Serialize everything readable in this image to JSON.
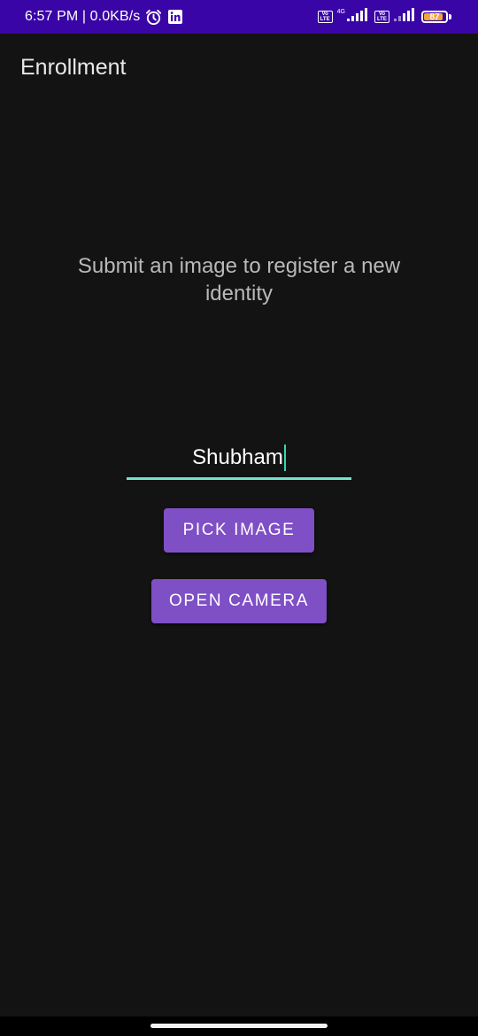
{
  "status_bar": {
    "time": "6:57 PM",
    "network_speed": "0.0KB/s",
    "alarm_icon": "alarm-clock-icon",
    "app_icon": "linkedin-icon",
    "sim1_badge_top": "Vo",
    "sim1_badge_bottom": "LTE",
    "network_type": "4G",
    "sim2_badge_top": "Vo",
    "sim2_badge_bottom": "LTE",
    "battery_percent": "87",
    "battery_level": 0.87,
    "background_color": "#3a05a6"
  },
  "app_bar": {
    "title": "Enrollment"
  },
  "main": {
    "instruction": "Submit an image to register a new identity",
    "name_input": {
      "value": "Shubham",
      "underline_color": "#6ee5cb"
    },
    "pick_image_label": "PICK IMAGE",
    "open_camera_label": "OPEN CAMERA",
    "button_color": "#7f4fc6"
  }
}
